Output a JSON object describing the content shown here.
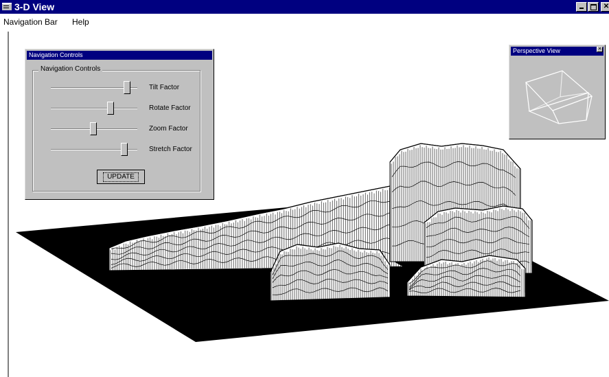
{
  "window": {
    "title": "3-D View"
  },
  "menubar": {
    "items": [
      "Navigation Bar",
      "Help"
    ]
  },
  "navigation_panel": {
    "title": "Navigation Controls",
    "group_label": "Navigation Controls",
    "sliders": [
      {
        "label": "Tilt Factor",
        "value": 0.88
      },
      {
        "label": "Rotate Factor",
        "value": 0.69
      },
      {
        "label": "Zoom Factor",
        "value": 0.49
      },
      {
        "label": "Stretch Factor",
        "value": 0.85
      }
    ],
    "update_label": "UPDATE"
  },
  "perspective_panel": {
    "title": "Perspective View"
  },
  "colors": {
    "titlebar": "#000080",
    "panel": "#c0c0c0",
    "ground": "#000000",
    "mesh": "#ffffff"
  }
}
